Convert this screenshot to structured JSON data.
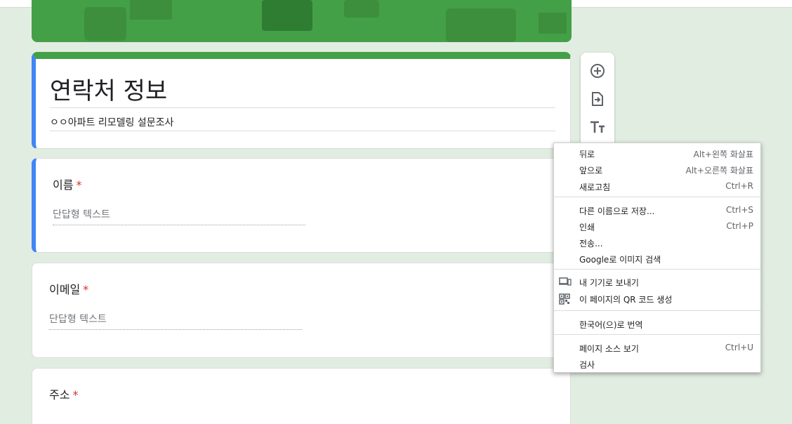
{
  "form": {
    "title": "연락처 정보",
    "description": "ㅇㅇ아파트 리모델링 설문조사"
  },
  "questions": [
    {
      "label": "이름",
      "required_mark": "*",
      "placeholder": "단답형 텍스트"
    },
    {
      "label": "이메일",
      "required_mark": "*",
      "placeholder": "단답형 텍스트"
    },
    {
      "label": "주소",
      "required_mark": "*"
    }
  ],
  "toolbar": {
    "icons": [
      "add-question-icon",
      "import-questions-icon",
      "add-title-icon"
    ]
  },
  "context_menu": {
    "groups": [
      [
        {
          "label": "뒤로",
          "shortcut": "Alt+왼쪽 화살표"
        },
        {
          "label": "앞으로",
          "shortcut": "Alt+오른쪽 화살표"
        },
        {
          "label": "새로고침",
          "shortcut": "Ctrl+R"
        }
      ],
      [
        {
          "label": "다른 이름으로 저장...",
          "shortcut": "Ctrl+S"
        },
        {
          "label": "인쇄",
          "shortcut": "Ctrl+P"
        },
        {
          "label": "전송..."
        },
        {
          "label": "Google로 이미지 검색"
        }
      ],
      [
        {
          "label": "내 기기로 보내기",
          "icon": "device-icon"
        },
        {
          "label": "이 페이지의 QR 코드 생성",
          "icon": "qr-code-icon"
        }
      ],
      [
        {
          "label": "한국어(으)로 번역"
        }
      ],
      [
        {
          "label": "페이지 소스 보기",
          "shortcut": "Ctrl+U"
        },
        {
          "label": "검사"
        }
      ]
    ]
  },
  "colors": {
    "background": "#e2ede2",
    "theme_green": "#43a047",
    "focus_blue": "#4285f4",
    "required_red": "#d93025"
  }
}
